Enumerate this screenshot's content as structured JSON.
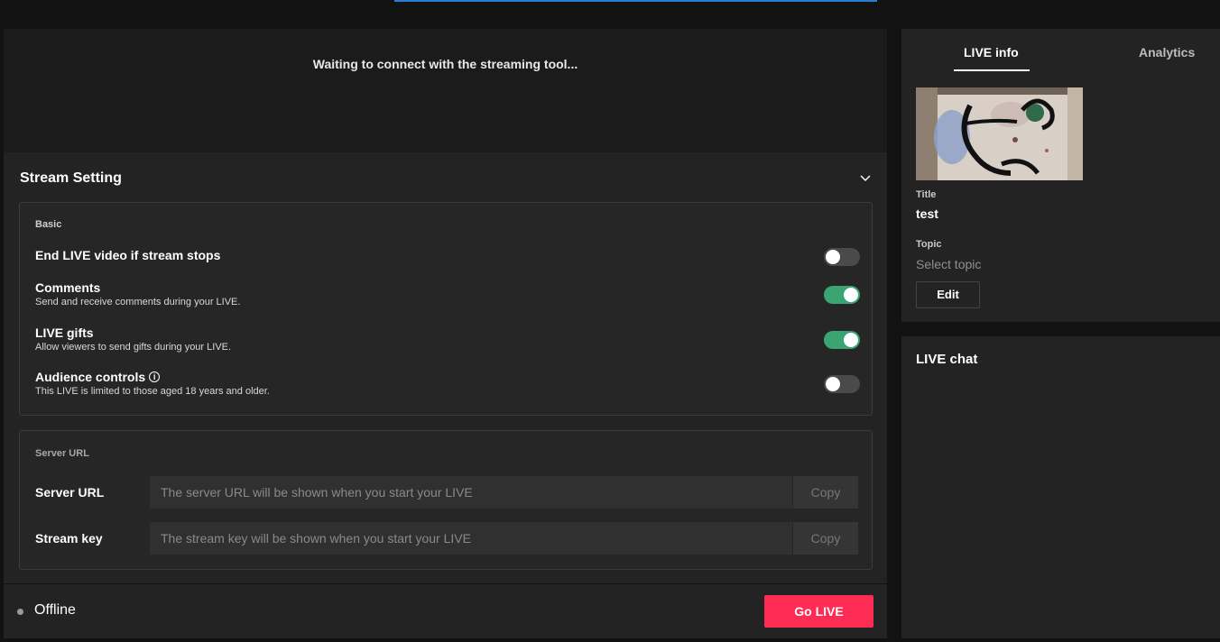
{
  "preview": {
    "message": "Waiting to connect with the streaming tool..."
  },
  "stream_setting": {
    "title": "Stream Setting",
    "basic": {
      "title": "Basic",
      "rows": [
        {
          "title": "End LIVE video if stream stops",
          "subtitle": "",
          "enabled": false
        },
        {
          "title": "Comments",
          "subtitle": "Send and receive comments during your LIVE.",
          "enabled": true
        },
        {
          "title": "LIVE gifts",
          "subtitle": "Allow viewers to send gifts during your LIVE.",
          "enabled": true
        },
        {
          "title": "Audience controls",
          "subtitle": "This LIVE is limited to those aged 18 years and older.",
          "enabled": false
        }
      ]
    },
    "server": {
      "title": "Server URL",
      "server_url": {
        "label": "Server URL",
        "value": "The server URL will be shown when you start your LIVE",
        "copy_label": "Copy"
      },
      "stream_key": {
        "label": "Stream key",
        "value": "The stream key will be shown when you start your LIVE",
        "copy_label": "Copy"
      }
    }
  },
  "footer": {
    "status": "Offline",
    "go_live_label": "Go LIVE"
  },
  "side_panel": {
    "tabs": [
      {
        "label": "LIVE info",
        "active": true
      },
      {
        "label": "Analytics",
        "active": false
      }
    ],
    "title_label": "Title",
    "title_value": "test",
    "topic_label": "Topic",
    "topic_placeholder": "Select topic",
    "edit_label": "Edit"
  },
  "chat": {
    "title": "LIVE chat"
  },
  "colors": {
    "accent": "#fe2c55",
    "toggle_on": "#3aa573",
    "panel": "#232323"
  }
}
